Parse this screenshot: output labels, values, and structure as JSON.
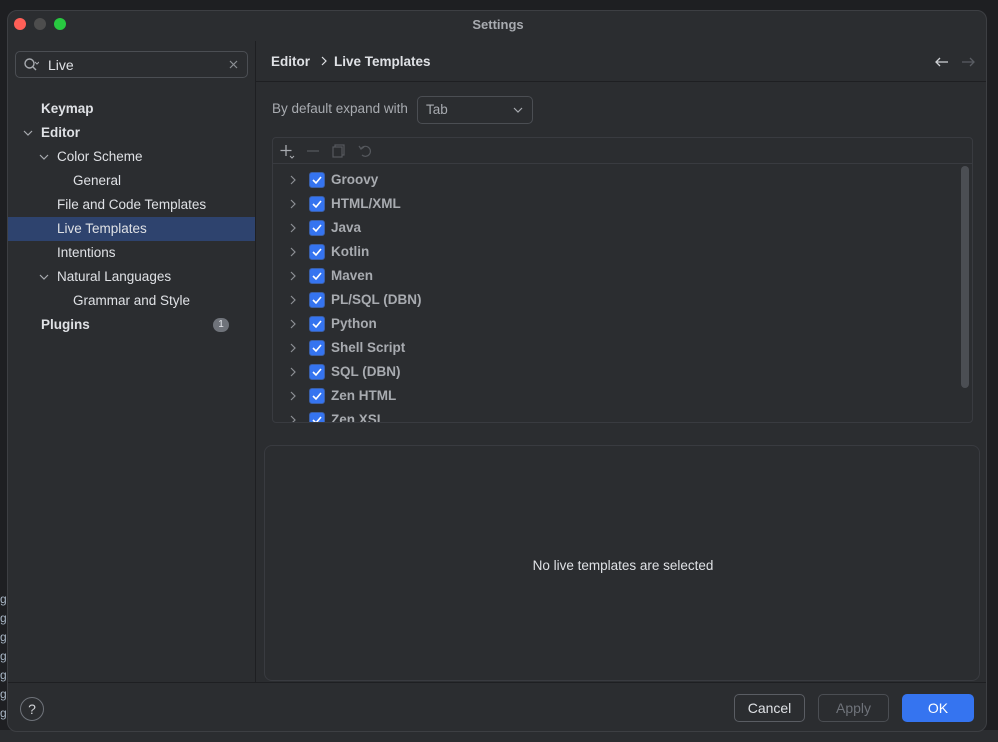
{
  "window": {
    "title": "Settings"
  },
  "search": {
    "value": "Live",
    "placeholder": ""
  },
  "sidebar": {
    "items": [
      {
        "label": "Keymap"
      },
      {
        "label": "Editor"
      },
      {
        "label": "Color Scheme"
      },
      {
        "label": "General"
      },
      {
        "label": "File and Code Templates"
      },
      {
        "label": "Live Templates"
      },
      {
        "label": "Intentions"
      },
      {
        "label": "Natural Languages"
      },
      {
        "label": "Grammar and Style"
      },
      {
        "label": "Plugins",
        "badge": "1"
      }
    ]
  },
  "breadcrumb": {
    "parent": "Editor",
    "current": "Live Templates"
  },
  "expand": {
    "label": "By default expand with",
    "value": "Tab"
  },
  "templates": {
    "groups": [
      {
        "label": "Groovy"
      },
      {
        "label": "HTML/XML"
      },
      {
        "label": "Java"
      },
      {
        "label": "Kotlin"
      },
      {
        "label": "Maven"
      },
      {
        "label": "PL/SQL (DBN)"
      },
      {
        "label": "Python"
      },
      {
        "label": "Shell Script"
      },
      {
        "label": "SQL (DBN)"
      },
      {
        "label": "Zen HTML"
      },
      {
        "label": "Zen XSL"
      }
    ]
  },
  "detail": {
    "message": "No live templates are selected"
  },
  "footer": {
    "help": "?",
    "cancel": "Cancel",
    "apply": "Apply",
    "ok": "OK"
  },
  "colors": {
    "accent": "#3574f0",
    "selection": "#2e436e",
    "background": "#2b2d30"
  },
  "background_app": {
    "gutter": [
      "g",
      "g",
      "g",
      "g",
      "g",
      "g",
      "g"
    ]
  }
}
